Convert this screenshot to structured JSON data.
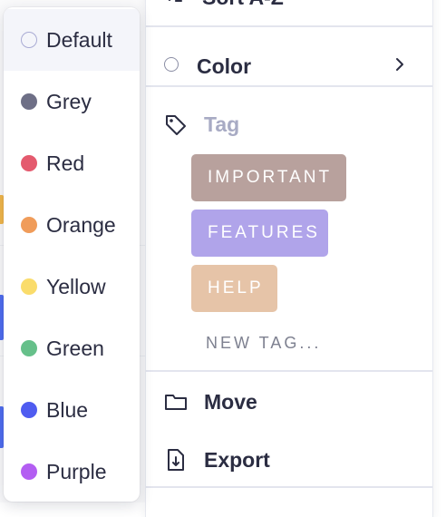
{
  "main_menu": {
    "sort_label": "Sort A-Z",
    "color_label": "Color",
    "tag_label": "Tag",
    "tags": [
      {
        "label": "IMPORTANT",
        "color": "#b8a19d"
      },
      {
        "label": "FEATURES",
        "color": "#b0a4ea"
      },
      {
        "label": "HELP",
        "color": "#e6c4a8"
      }
    ],
    "new_tag_label": "NEW TAG...",
    "move_label": "Move",
    "export_label": "Export"
  },
  "color_submenu": {
    "selected": "Default",
    "options": [
      {
        "label": "Default",
        "color": "#a9abd4"
      },
      {
        "label": "Grey",
        "color": "#6e6f86"
      },
      {
        "label": "Red",
        "color": "#e45a6e"
      },
      {
        "label": "Orange",
        "color": "#f09c5a"
      },
      {
        "label": "Yellow",
        "color": "#fadc6b"
      },
      {
        "label": "Green",
        "color": "#66c08a"
      },
      {
        "label": "Blue",
        "color": "#4f5cf0"
      },
      {
        "label": "Purple",
        "color": "#b35ef2"
      }
    ]
  },
  "icons": [
    "sort-az-icon",
    "radio-circle-icon",
    "chevron-right-icon",
    "tag-icon",
    "folder-icon",
    "export-file-icon"
  ]
}
